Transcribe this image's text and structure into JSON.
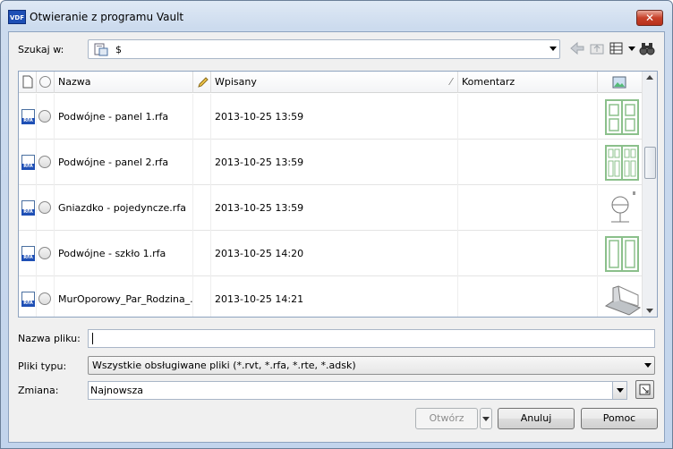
{
  "window": {
    "title": "Otwieranie z programu Vault",
    "app_icon_text": "VDF",
    "close_label": "✕"
  },
  "lookin": {
    "label": "Szukaj w:",
    "value": "$"
  },
  "columns": {
    "name": "Nazwa",
    "checked_in": "Wpisany",
    "comment": "Komentarz"
  },
  "rows": [
    {
      "name": "Podwójne - panel 1.rfa",
      "date": "2013-10-25 13:59",
      "thumb": "double-door-panel-icon"
    },
    {
      "name": "Podwójne - panel 2.rfa",
      "date": "2013-10-25 13:59",
      "thumb": "double-door-panel-2-icon"
    },
    {
      "name": "Gniazdko - pojedyncze.rfa",
      "date": "2013-10-25 13:59",
      "thumb": "socket-icon"
    },
    {
      "name": "Podwójne - szkło 1.rfa",
      "date": "2013-10-25 14:20",
      "thumb": "double-door-glass-icon"
    },
    {
      "name": "MurOporowy_Par_Rodzina_...",
      "date": "2013-10-25 14:21",
      "thumb": "retaining-wall-icon"
    }
  ],
  "filename": {
    "label": "Nazwa pliku:",
    "value": ""
  },
  "filetype": {
    "label": "Pliki typu:",
    "value": "Wszystkie obsługiwane pliki (*.rvt, *.rfa, *.rte, *.adsk)"
  },
  "revision": {
    "label": "Zmiana:",
    "value": "Najnowsza"
  },
  "buttons": {
    "open": "Otwórz",
    "cancel": "Anuluj",
    "help": "Pomoc"
  },
  "file_badge": "RFA"
}
